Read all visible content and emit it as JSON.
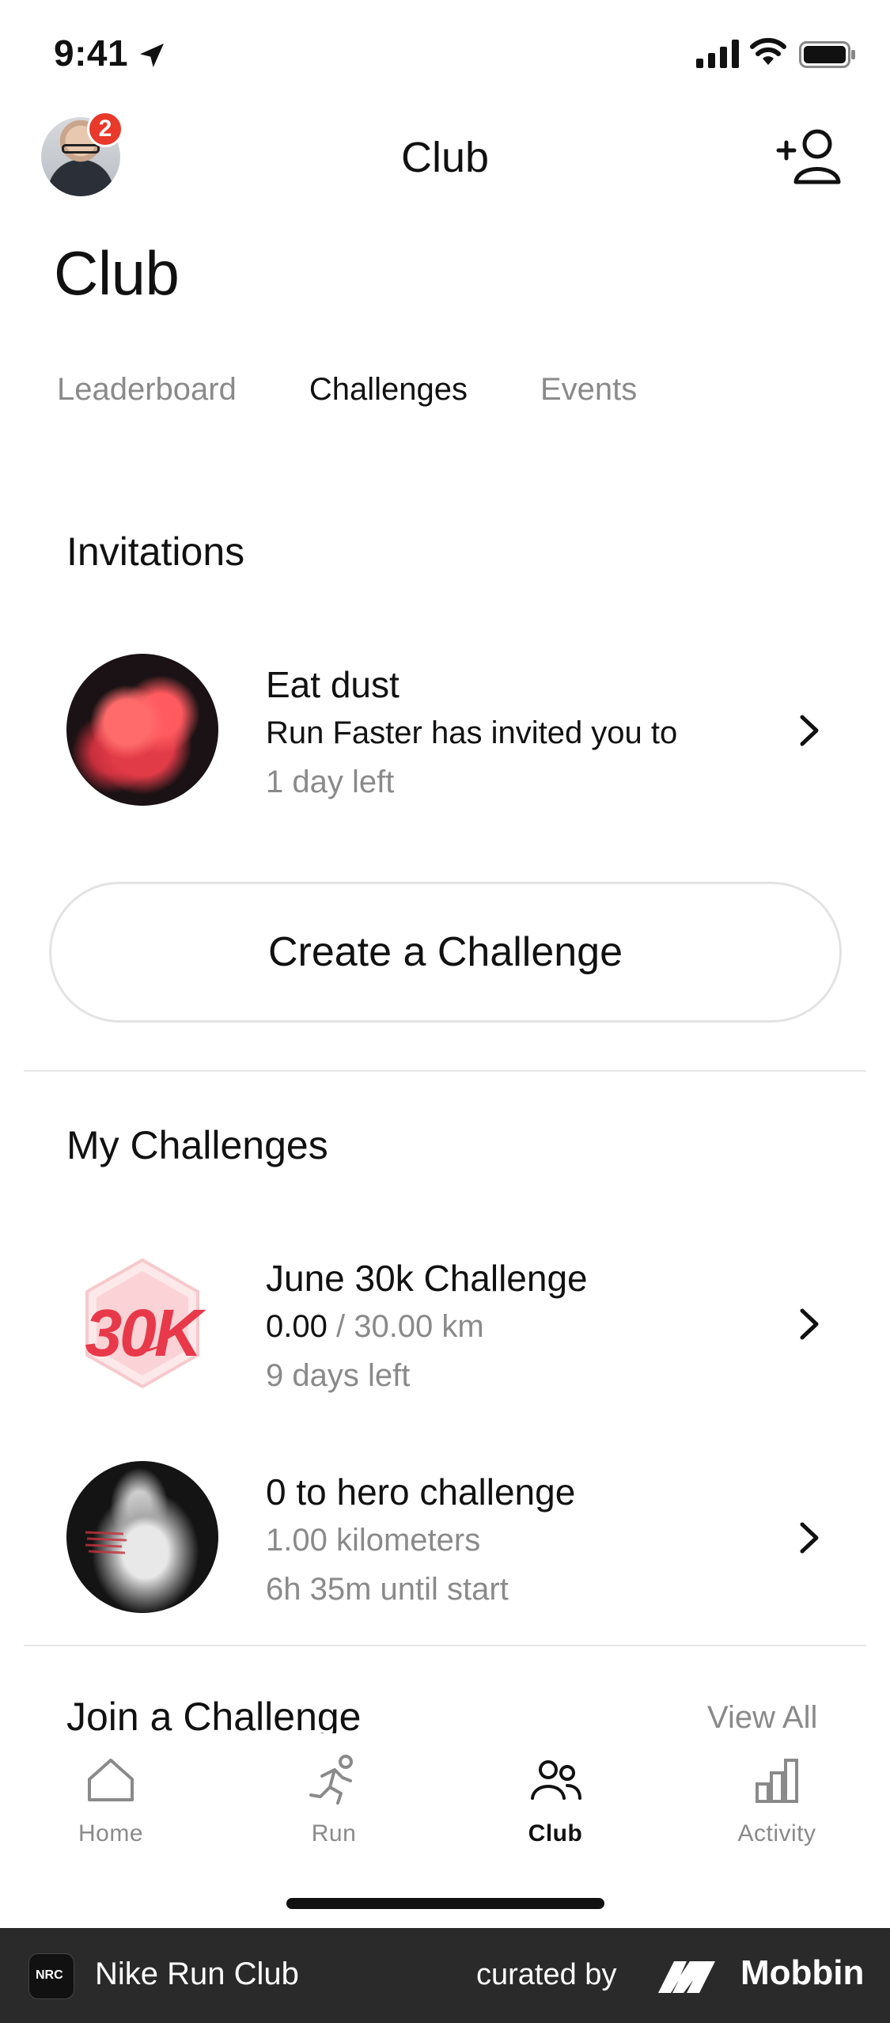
{
  "status_bar": {
    "time": "9:41"
  },
  "nav": {
    "title": "Club",
    "badge_count": "2"
  },
  "page": {
    "title": "Club"
  },
  "tabs": [
    {
      "label": "Leaderboard",
      "active": false
    },
    {
      "label": "Challenges",
      "active": true
    },
    {
      "label": "Events",
      "active": false
    }
  ],
  "invitations": {
    "heading": "Invitations",
    "items": [
      {
        "title": "Eat dust",
        "subtitle": "Run Faster has invited you to",
        "meta": "1 day left"
      }
    ]
  },
  "create_button": {
    "label": "Create a Challenge"
  },
  "my_challenges": {
    "heading": "My Challenges",
    "items": [
      {
        "title": "June 30k Challenge",
        "progress_value": "0.00",
        "progress_total": " / 30.00 km",
        "meta": "9 days left",
        "badge_text": "30K"
      },
      {
        "title": "0 to hero challenge",
        "subtitle": "1.00 kilometers",
        "meta": "6h 35m until start"
      }
    ]
  },
  "join": {
    "heading": "Join a Challenge",
    "view_all": "View All"
  },
  "tabbar": [
    {
      "label": "Home",
      "icon": "home-icon",
      "active": false
    },
    {
      "label": "Run",
      "icon": "run-icon",
      "active": false
    },
    {
      "label": "Club",
      "icon": "club-icon",
      "active": true
    },
    {
      "label": "Activity",
      "icon": "activity-icon",
      "active": false
    }
  ],
  "footer": {
    "app_name": "Nike Run Club",
    "app_icon_text": "NRC",
    "curated_by": "curated by",
    "brand": "Mobbin"
  },
  "colors": {
    "badge": "#e8392a",
    "muted": "#8a8a8a",
    "text": "#111111",
    "footer_bg": "#2a2a2a"
  }
}
